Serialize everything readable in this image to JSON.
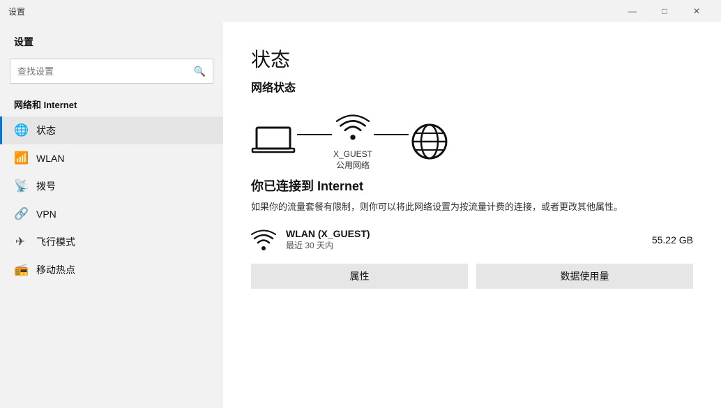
{
  "titlebar": {
    "title": "设置",
    "minimize": "—",
    "maximize": "□",
    "close": "✕"
  },
  "sidebar": {
    "header": "设置",
    "search_placeholder": "查找设置",
    "section_label": "网络和 Internet",
    "nav_items": [
      {
        "id": "status",
        "label": "状态",
        "icon": "🌐",
        "active": true
      },
      {
        "id": "wlan",
        "label": "WLAN",
        "icon": "📶",
        "active": false
      },
      {
        "id": "dial",
        "label": "拨号",
        "icon": "📡",
        "active": false
      },
      {
        "id": "vpn",
        "label": "VPN",
        "icon": "🔗",
        "active": false
      },
      {
        "id": "airplane",
        "label": "飞行模式",
        "icon": "✈",
        "active": false
      },
      {
        "id": "hotspot",
        "label": "移动热点",
        "icon": "📻",
        "active": false
      }
    ]
  },
  "content": {
    "page_title": "状态",
    "section_title": "网络状态",
    "wifi_name": "X_GUEST",
    "wifi_type": "公用网络",
    "connected_title": "你已连接到 Internet",
    "connected_desc": "如果你的流量套餐有限制，则你可以将此网络设置为按流量计费的连接，或者更改其他属性。",
    "network_name": "WLAN (X_GUEST)",
    "network_period": "最近 30 天内",
    "network_usage": "55.22 GB",
    "btn_properties": "属性",
    "btn_data_usage": "数据使用量"
  }
}
